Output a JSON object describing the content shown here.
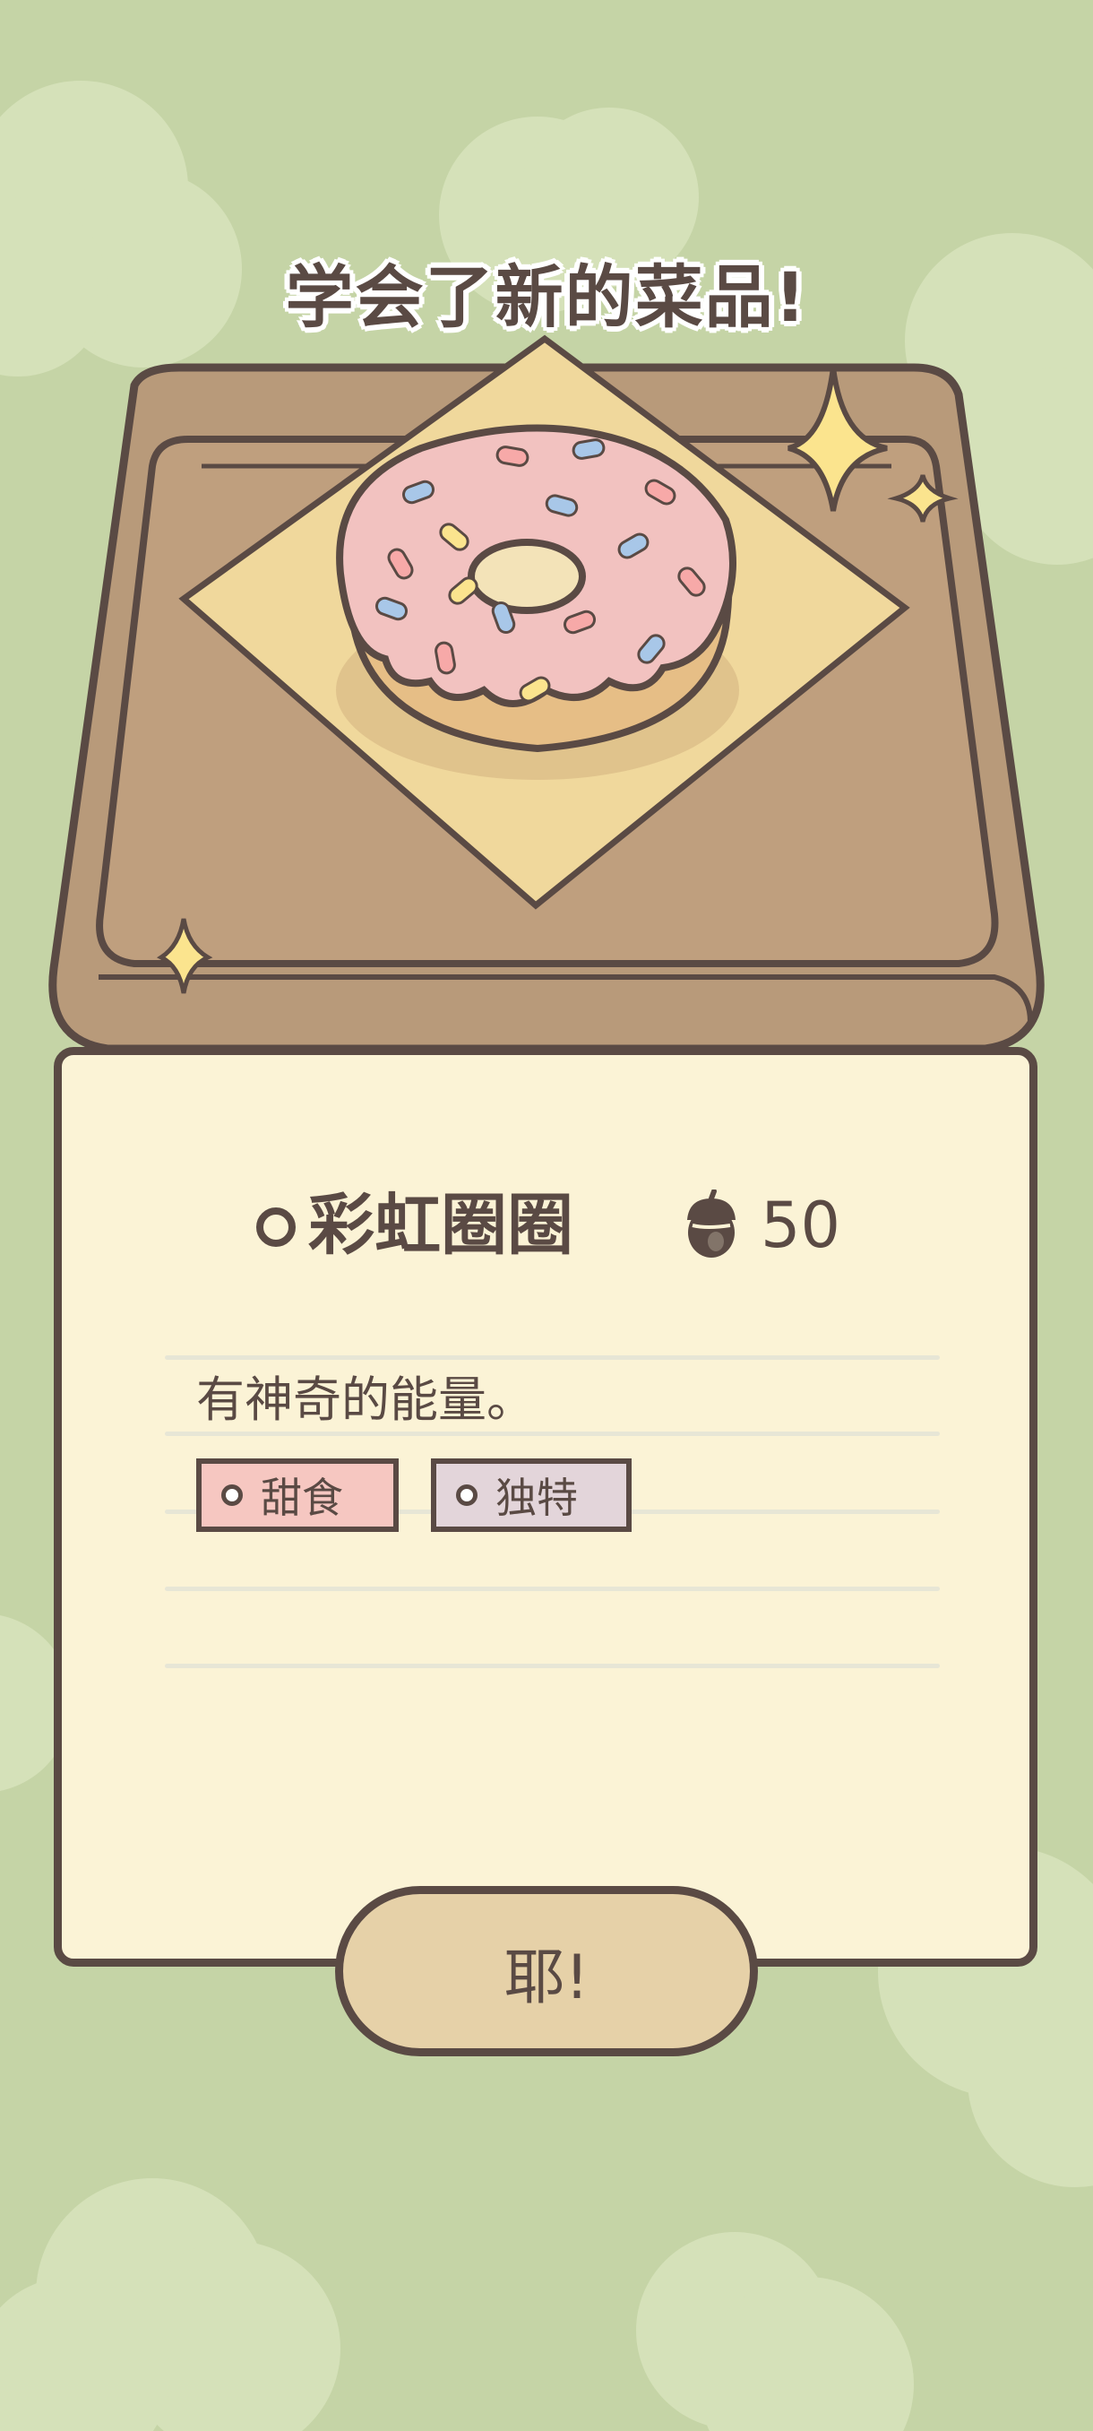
{
  "header": {
    "title": "学会了新的菜品!"
  },
  "dish": {
    "name": "彩虹圈圈",
    "price": "50",
    "currency_icon": "acorn-icon",
    "description": "有神奇的能量。",
    "tags": [
      {
        "label": "甜食",
        "color": "#f6c7c1"
      },
      {
        "label": "独特",
        "color": "#e3d5da"
      }
    ]
  },
  "confirm_button": {
    "label": "耶!"
  },
  "colors": {
    "background": "#c5d4a6",
    "card": "#fbf3d6",
    "outline": "#5a4a44",
    "tray": "#b89a7a",
    "button": "#e6d1a8"
  }
}
